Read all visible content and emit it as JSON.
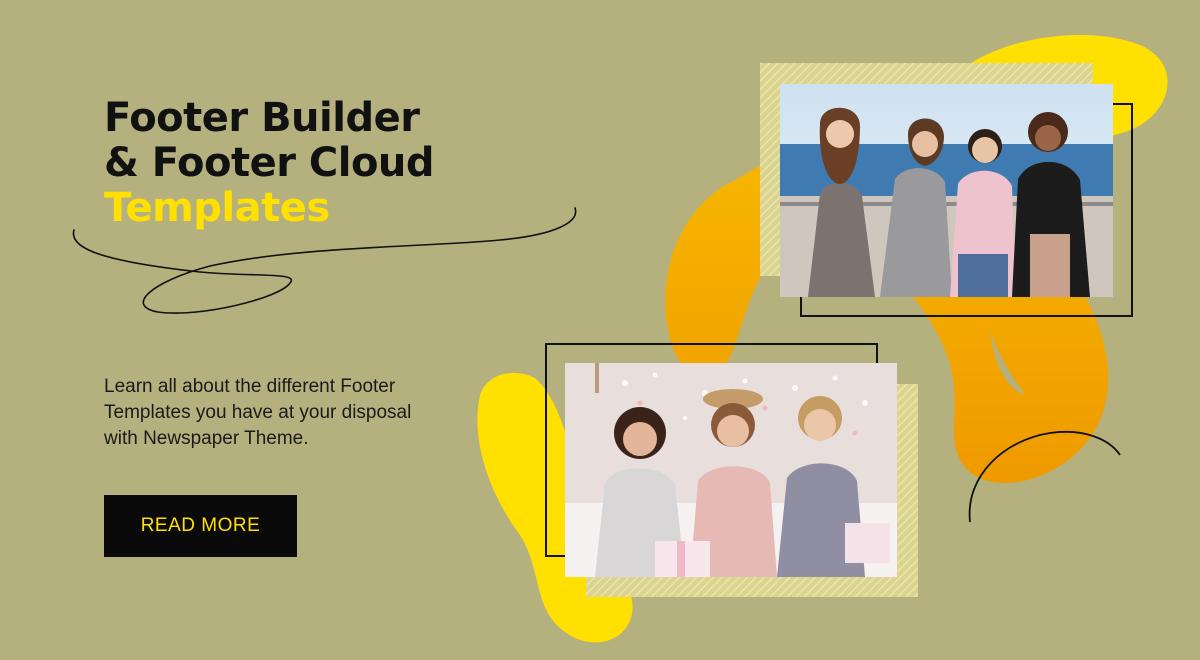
{
  "hero": {
    "title_line_1": "Footer Builder",
    "title_line_2": "& Footer Cloud",
    "title_accent": "Templates",
    "description": "Learn all about the different Footer Templates you have at your disposal with Newspaper Theme.",
    "cta_label": "READ MORE"
  },
  "colors": {
    "background": "#b5b17f",
    "accent_yellow": "#ffe000",
    "accent_orange": "#f2a400",
    "text_dark": "#111111",
    "button_bg": "#0a0a0a"
  }
}
